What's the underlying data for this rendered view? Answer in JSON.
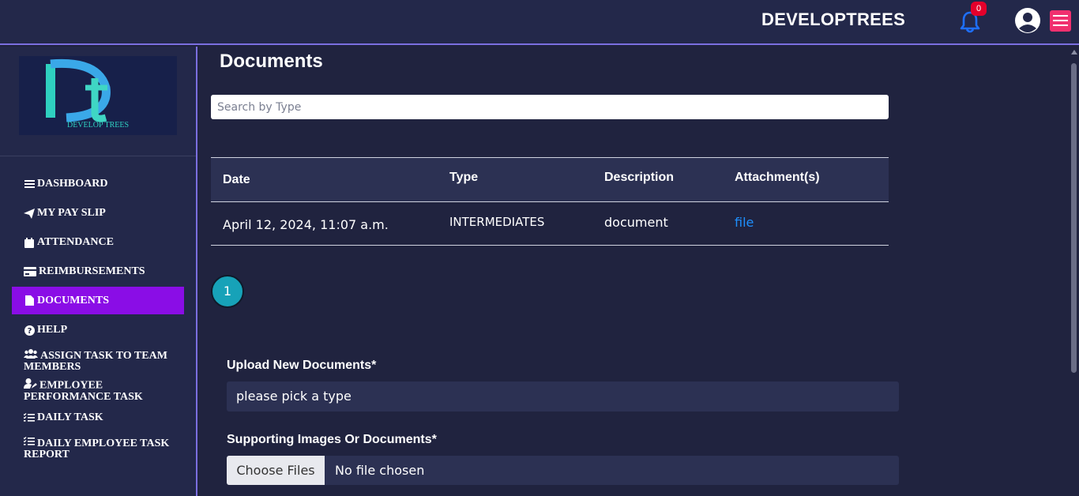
{
  "header": {
    "brand": "DEVELOPTREES",
    "notification_count": "0",
    "bell_icon": "bell-icon",
    "user_icon": "user-circle-icon",
    "menu_icon": "hamburger-icon"
  },
  "sidebar": {
    "logo_text": "DEVELOP TREES",
    "items": [
      {
        "label": "DASHBOARD",
        "icon": "bars-icon"
      },
      {
        "label": "MY PAY SLIP",
        "icon": "paper-plane-icon"
      },
      {
        "label": "ATTENDANCE",
        "icon": "calendar-icon"
      },
      {
        "label": "REIMBURSEMENTS",
        "icon": "credit-card-icon"
      },
      {
        "label": "DOCUMENTS",
        "icon": "file-icon"
      },
      {
        "label": "HELP",
        "icon": "question-circle-icon"
      },
      {
        "label": "ASSIGN TASK TO TEAM MEMBERS",
        "icon": "users-icon"
      },
      {
        "label": "EMPLOYEE PERFORMANCE TASK",
        "icon": "user-edit-icon"
      },
      {
        "label": "DAILY TASK",
        "icon": "list-check-icon"
      },
      {
        "label": "DAILY EMPLOYEE TASK REPORT",
        "icon": "list-check-icon"
      }
    ]
  },
  "main": {
    "title": "Documents",
    "search_placeholder": "Search by Type",
    "table": {
      "headers": [
        "Date",
        "Type",
        "Description",
        "Attachment(s)"
      ],
      "rows": [
        {
          "date": "April 12, 2024, 11:07 a.m.",
          "type": "INTERMEDIATES",
          "description": "document",
          "attachment": "file"
        }
      ]
    },
    "page_number": "1",
    "upload": {
      "label": "Upload New Documents*",
      "select_value": "please pick a type"
    },
    "supporting": {
      "label": "Supporting Images Or Documents*",
      "button": "Choose Files",
      "status": "No file chosen"
    }
  },
  "colors": {
    "background": "#20233f",
    "panel": "#23284a",
    "accent": "#8a0de6",
    "link": "#1e90ff",
    "badge": "#e4002b",
    "menu_button": "#f0306f",
    "pager": "#17a2b8"
  }
}
